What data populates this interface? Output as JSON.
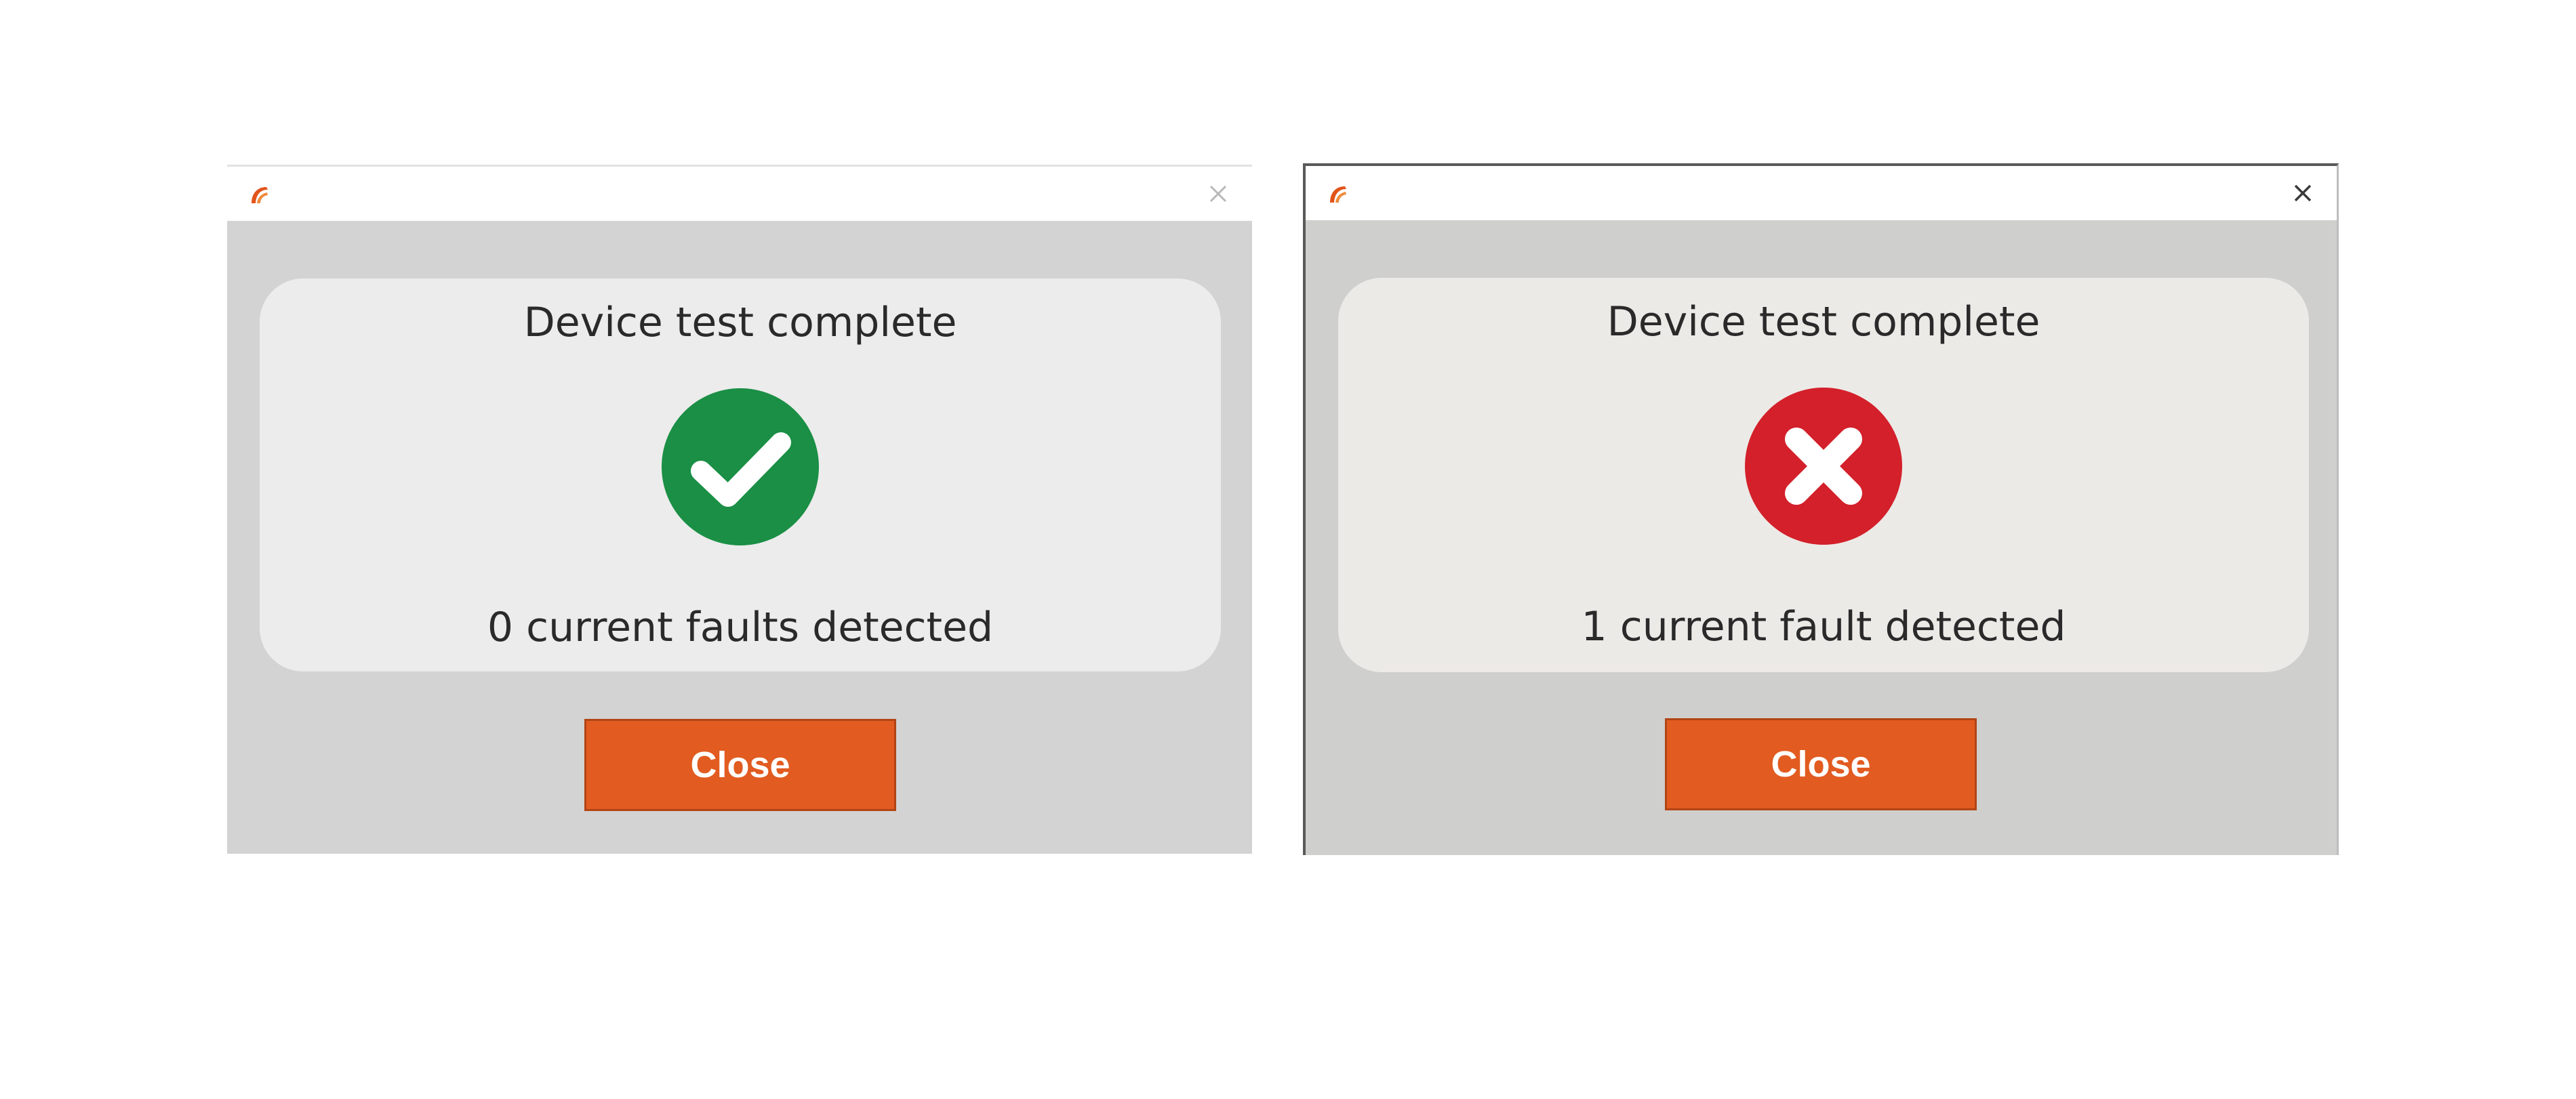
{
  "dialogs": [
    {
      "heading": "Device test complete",
      "status": "pass",
      "status_icon": "check-circle-icon",
      "status_color": "#1a8f45",
      "fault_text": "0 current faults detected",
      "close_button_label": "Close"
    },
    {
      "heading": "Device test complete",
      "status": "fail",
      "status_icon": "x-circle-icon",
      "status_color": "#d3202a",
      "fault_text": "1 current fault detected",
      "close_button_label": "Close"
    }
  ],
  "colors": {
    "accent_button": "#e25b20",
    "dialog_background": "#d3d3d3",
    "panel_background": "#ececec"
  }
}
